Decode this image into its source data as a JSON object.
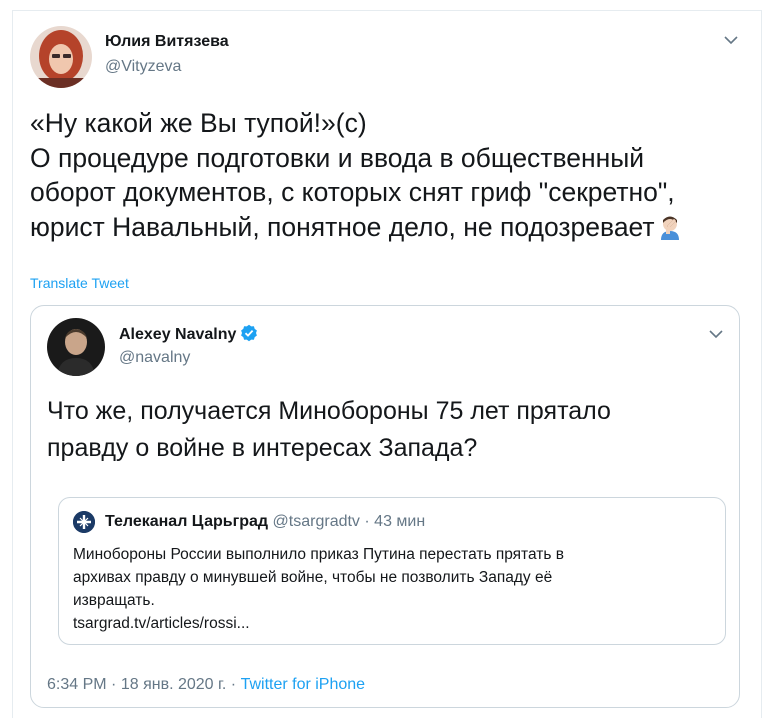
{
  "tweet": {
    "author_name": "Юлия Витязева",
    "author_handle": "@Vityzeva",
    "text_lines": [
      "«Ну какой же Вы тупой!»(с)",
      "О процедуре подготовки и ввода в общественный",
      "оборот документов, с которых снят гриф \"секретно\",",
      "юрист Навальный, понятное дело, не подозревает"
    ],
    "emoji": "facepalm-icon",
    "translate_label": "Translate Tweet"
  },
  "quoted": {
    "author_name": "Alexey Navalny",
    "author_handle": "@navalny",
    "verified": true,
    "text_lines": [
      "Что же, получается Минобороны 75 лет прятало",
      "правду о войне в интересах Запада?"
    ],
    "inner": {
      "author_name": "Телеканал Царьград",
      "author_handle": "@tsargradtv",
      "separator": "·",
      "time": "43 мин",
      "text_lines": [
        "Минобороны России выполнило приказ Путина перестать прятать в",
        "архивах правду о минувшей войне, чтобы не позволить Западу её",
        "извращать.",
        "tsargrad.tv/articles/rossi..."
      ]
    },
    "footer": {
      "time": "6:34 PM",
      "sep1": "·",
      "date": "18 янв. 2020 г.",
      "sep2": "·",
      "source": "Twitter for iPhone"
    }
  },
  "colors": {
    "text": "#14171a",
    "secondary": "#657786",
    "link": "#1da1f2",
    "border": "#ccd6dd"
  }
}
